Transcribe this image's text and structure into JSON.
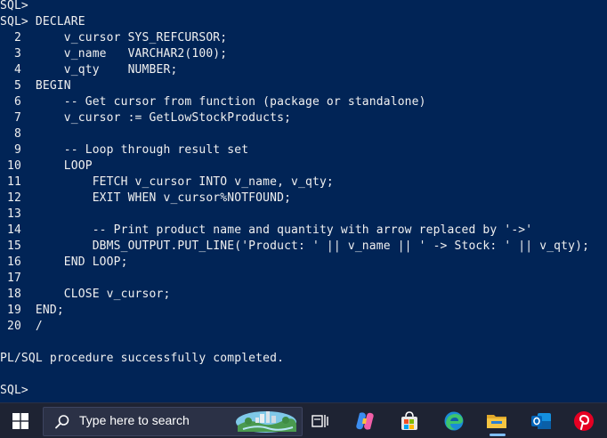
{
  "terminal": {
    "lines": [
      "SQL>",
      "SQL> DECLARE",
      "  2      v_cursor SYS_REFCURSOR;",
      "  3      v_name   VARCHAR2(100);",
      "  4      v_qty    NUMBER;",
      "  5  BEGIN",
      "  6      -- Get cursor from function (package or standalone)",
      "  7      v_cursor := GetLowStockProducts;",
      "  8",
      "  9      -- Loop through result set",
      " 10      LOOP",
      " 11          FETCH v_cursor INTO v_name, v_qty;",
      " 12          EXIT WHEN v_cursor%NOTFOUND;",
      " 13",
      " 14          -- Print product name and quantity with arrow replaced by '->'",
      " 15          DBMS_OUTPUT.PUT_LINE('Product: ' || v_name || ' -> Stock: ' || v_qty);",
      " 16      END LOOP;",
      " 17",
      " 18      CLOSE v_cursor;",
      " 19  END;",
      " 20  /",
      "",
      "PL/SQL procedure successfully completed.",
      "",
      "SQL>"
    ]
  },
  "taskbar": {
    "search_placeholder": "Type here to search",
    "icons": [
      "windows-start-icon",
      "search-icon",
      "search-highlight-landscape-icon",
      "task-view-icon",
      "copilot-icon",
      "microsoft-store-icon",
      "edge-icon",
      "file-explorer-icon",
      "outlook-icon",
      "pinterest-icon"
    ]
  },
  "colors": {
    "terminal_bg": "#012456",
    "terminal_fg": "#ffffff",
    "taskbar_bg": "#1e2333"
  }
}
